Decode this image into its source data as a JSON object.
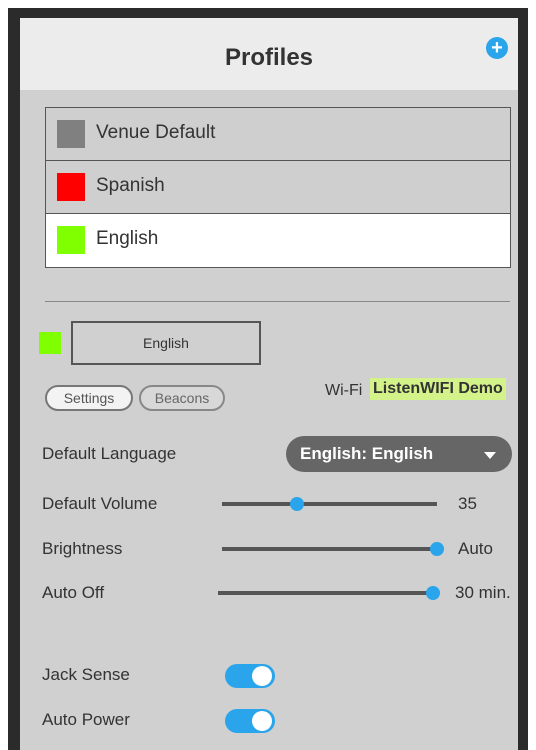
{
  "header": {
    "title": "Profiles",
    "add_icon": "+"
  },
  "profiles": [
    {
      "name": "Venue Default",
      "color": "#808080",
      "selected": false
    },
    {
      "name": "Spanish",
      "color": "#ff0000",
      "selected": false
    },
    {
      "name": "English",
      "color": "#80ff00",
      "selected": true
    }
  ],
  "current_profile": {
    "name": "English",
    "color": "#80ff00"
  },
  "tabs": [
    {
      "label": "Settings",
      "active": true
    },
    {
      "label": "Beacons",
      "active": false
    }
  ],
  "wifi": {
    "label": "Wi-Fi",
    "network": "ListenWIFI Demo"
  },
  "settings": {
    "default_language": {
      "label": "Default Language",
      "value": "English: English"
    },
    "default_volume": {
      "label": "Default Volume",
      "value": "35",
      "level": 0.35
    },
    "brightness": {
      "label": "Brightness",
      "value": "Auto",
      "level": 1.0
    },
    "auto_off": {
      "label": "Auto Off",
      "value": "30 min.",
      "level": 1.0
    },
    "jack_sense": {
      "label": "Jack Sense",
      "on": true
    },
    "auto_power": {
      "label": "Auto Power",
      "on": true
    }
  },
  "colors": {
    "accent": "#2aa4ea",
    "header_bg": "#ececec",
    "panel_bg": "#d0d0d0",
    "wifi_highlight": "#d4f28a"
  }
}
